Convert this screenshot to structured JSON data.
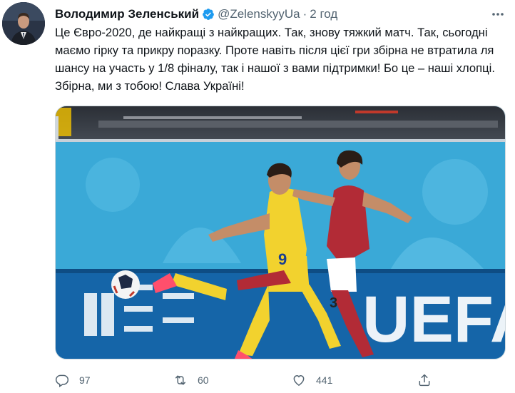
{
  "tweet": {
    "author_name": "Володимир Зеленський",
    "handle": "@ZelenskyyUa",
    "separator": "·",
    "time": "2 год",
    "text": "Це Євро-2020, де найкращі з найкращих. Так, знову тяжкий матч. Так, сьогодні маємо гірку та прикру поразку. Проте навіть після цієї гри збірна не втратила ля шансу на участь у 1/8 фіналу, так і нашої з вами підтримки! Бо це – наші хлопці. Збірна, ми з тобою! Слава Україні!"
  },
  "media": {
    "banner_text": "UEFA",
    "player_ukraine_number": "9",
    "player_austria_number": "3"
  },
  "actions": {
    "reply_count": "97",
    "retweet_count": "60",
    "like_count": "441"
  },
  "icons": {
    "verified": "verified-badge-icon",
    "more": "more-options-icon",
    "reply": "reply-icon",
    "retweet": "retweet-icon",
    "like": "like-icon",
    "share": "share-icon"
  },
  "colors": {
    "verified_blue": "#1d9bf0",
    "secondary_text": "#536471",
    "primary_text": "#0f1419"
  }
}
